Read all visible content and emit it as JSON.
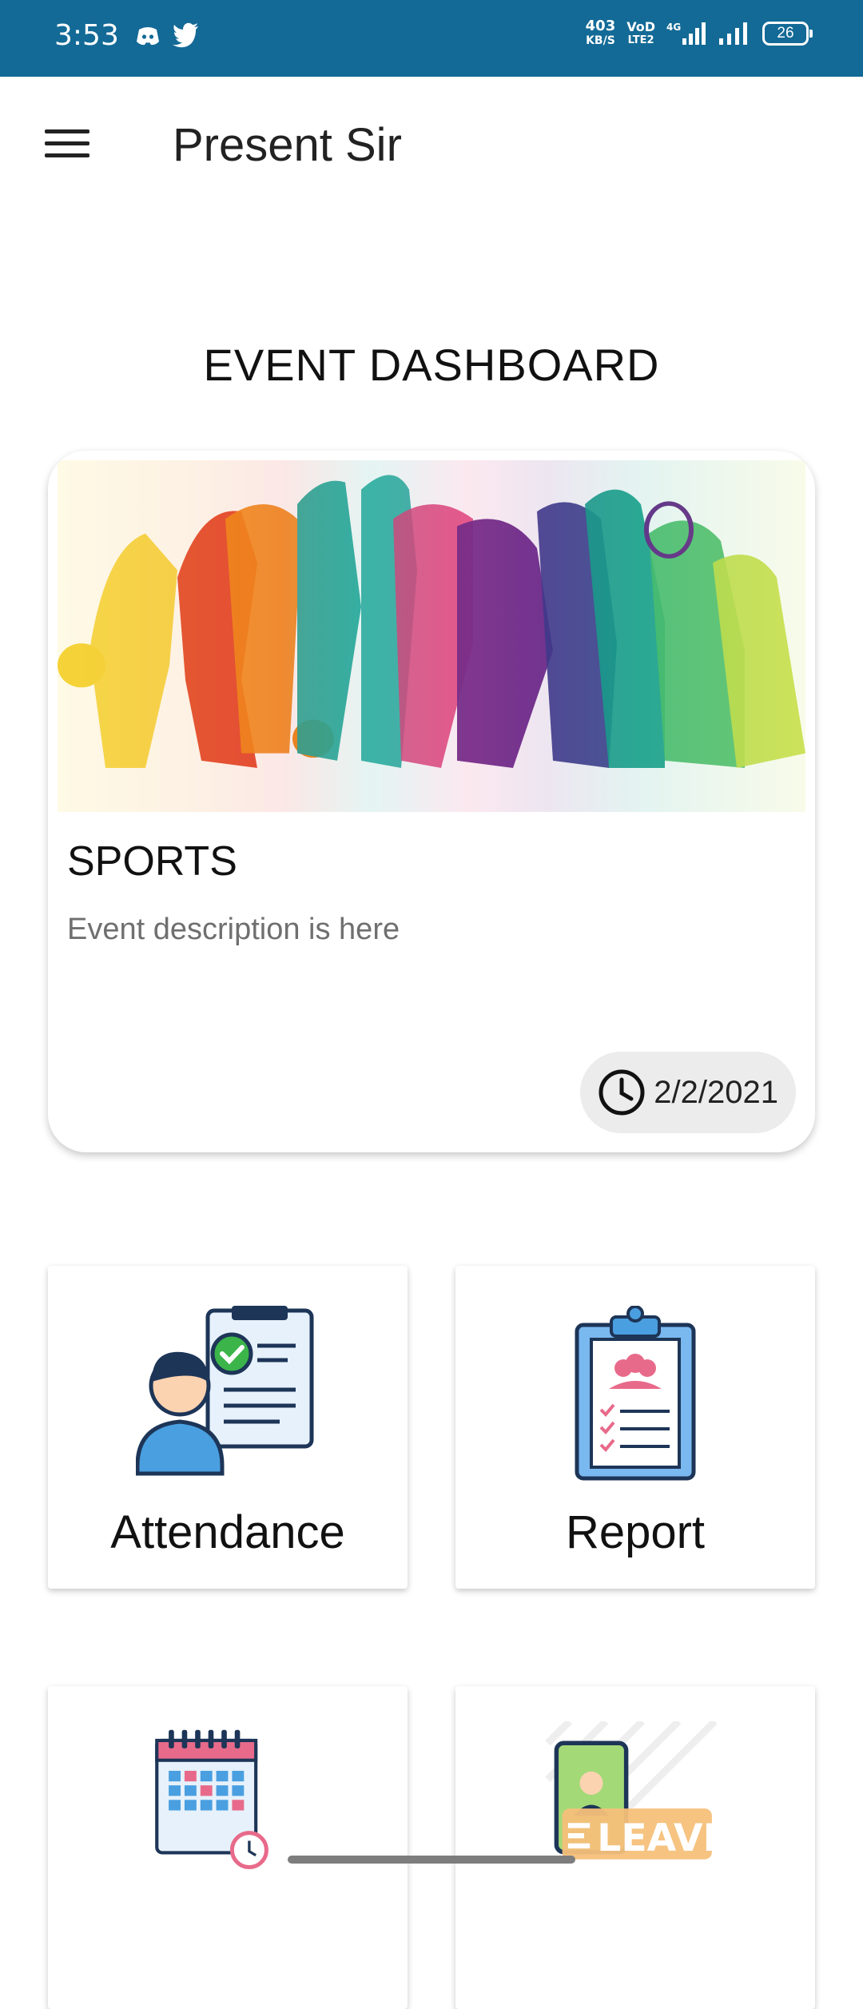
{
  "status_bar": {
    "time": "3:53",
    "net_speed_value": "403",
    "net_speed_unit": "KB/S",
    "volte_top": "VoD",
    "volte_bottom": "LTE2",
    "network": "4G",
    "battery": "26"
  },
  "app_bar": {
    "title": "Present Sir",
    "menu_icon": "hamburger-menu-icon"
  },
  "dashboard": {
    "heading": "EVENT DASHBOARD"
  },
  "event_card": {
    "title": "SPORTS",
    "description": "Event description is here",
    "date": "2/2/2021",
    "date_icon": "clock-icon"
  },
  "tiles": [
    {
      "label": "Attendance",
      "icon": "attendance-icon"
    },
    {
      "label": "Report",
      "icon": "report-clipboard-icon"
    },
    {
      "label": "",
      "icon": "calendar-icon"
    },
    {
      "label": "LEAVE",
      "icon": "leave-icon"
    }
  ],
  "colors": {
    "status_bar": "#136a96",
    "accent_blue": "#4a9fe0",
    "accent_green": "#3bb54a",
    "accent_pink": "#e86a8a"
  }
}
